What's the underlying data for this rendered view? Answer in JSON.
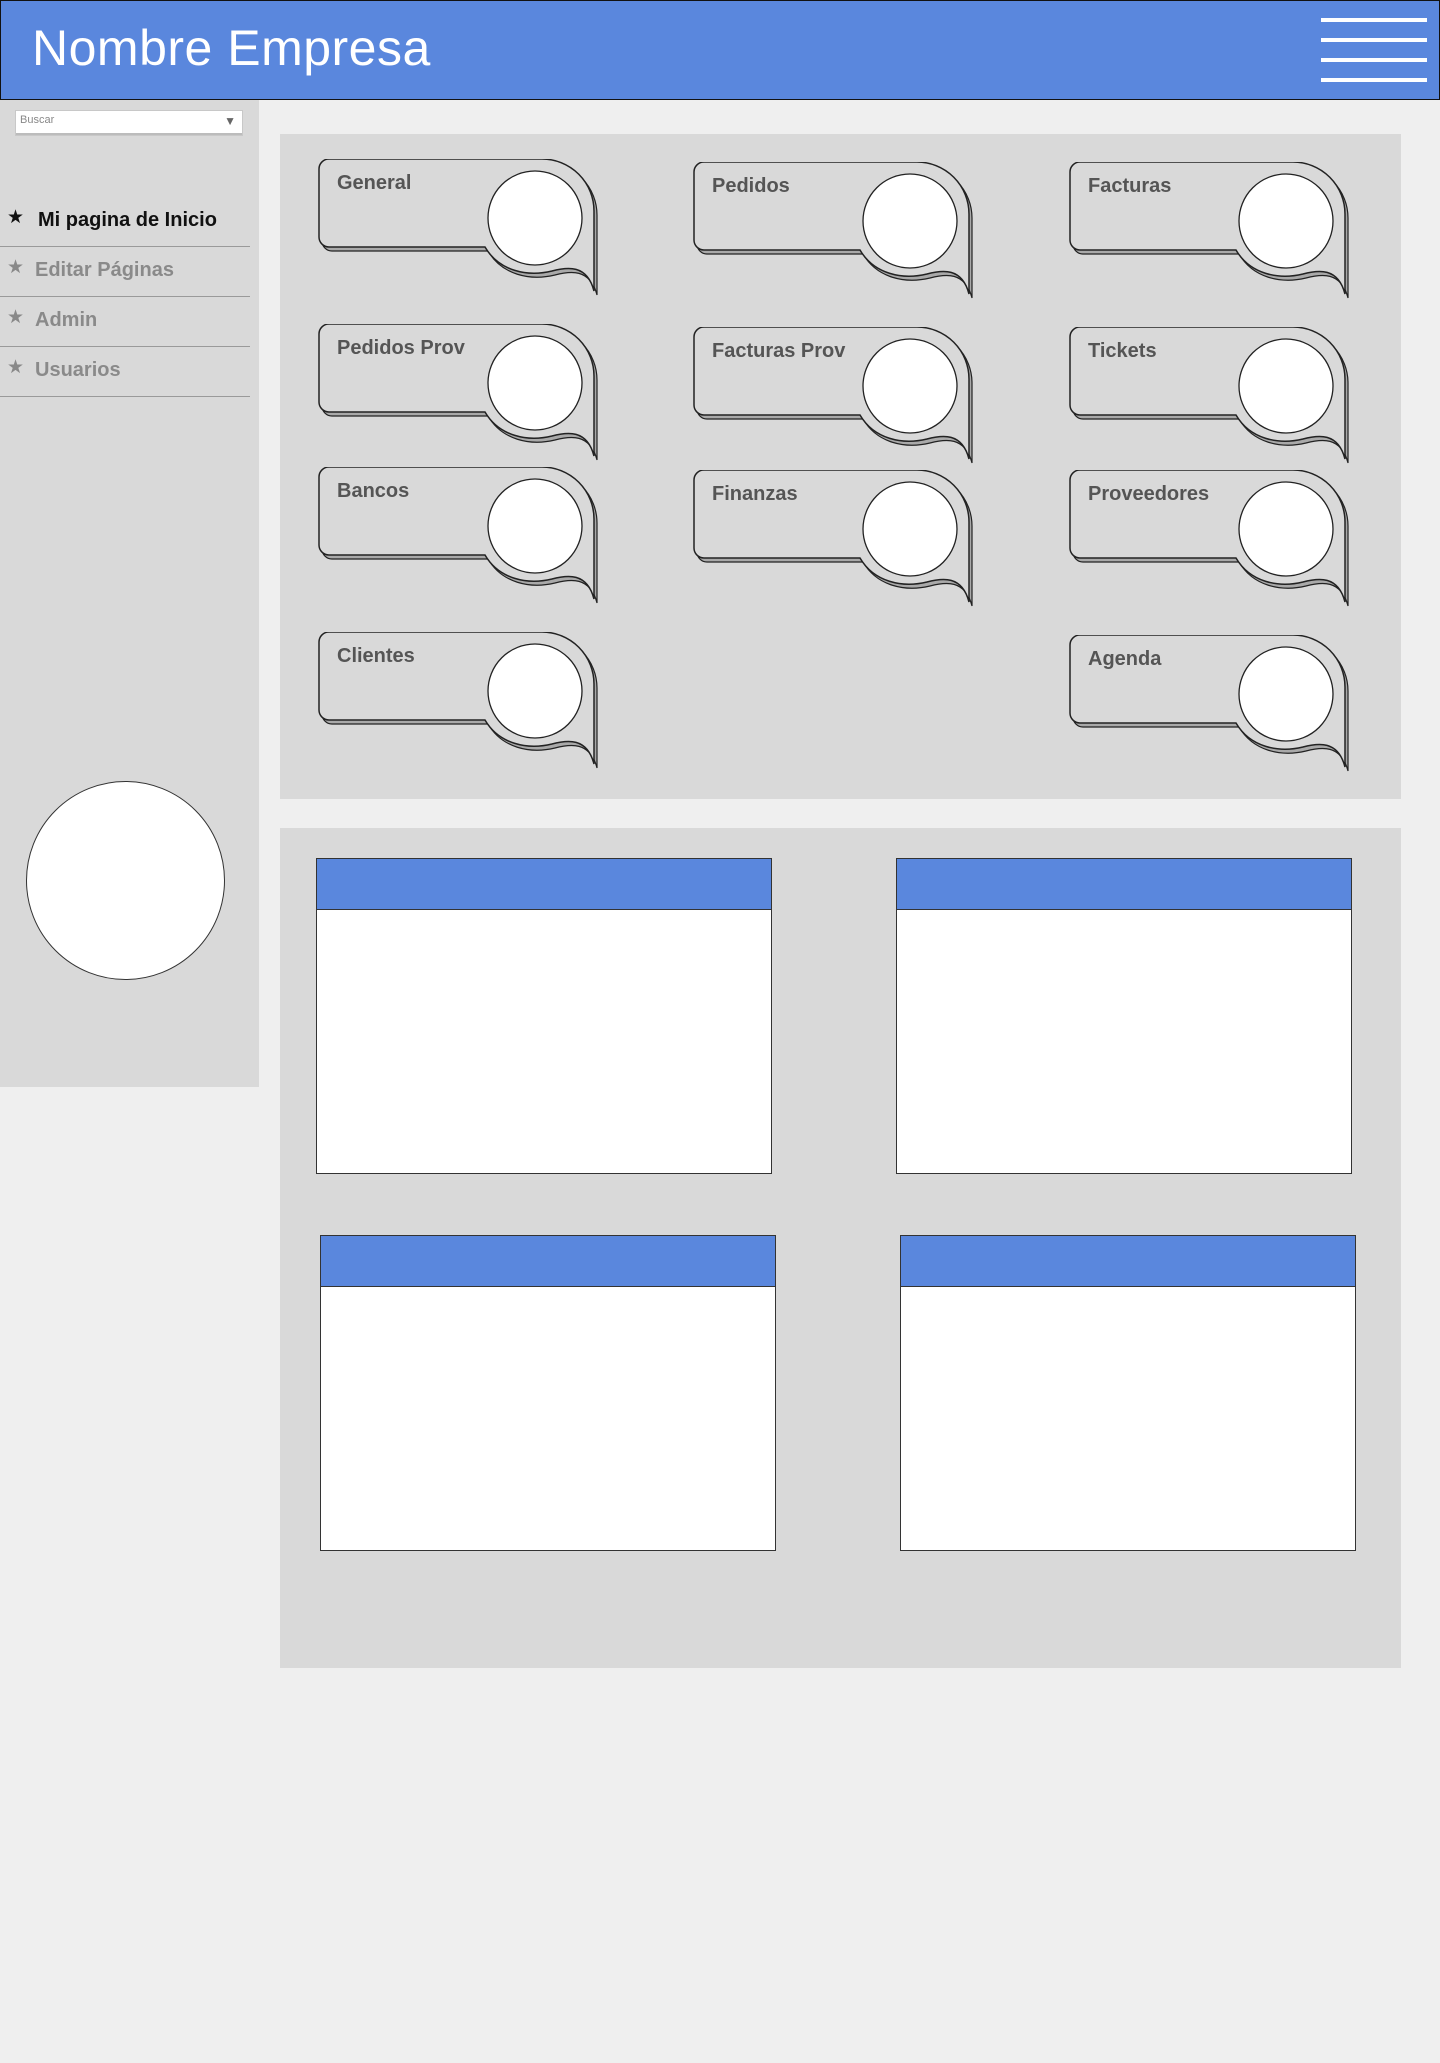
{
  "header": {
    "brand": "Nombre Empresa",
    "menu_icon": "hamburger-menu-icon",
    "color": "#5a87dd"
  },
  "sidebar": {
    "search": {
      "placeholder": "Buscar",
      "value": ""
    },
    "items": [
      {
        "label": "Mi pagina de Inicio",
        "icon": "star-icon",
        "active": true
      },
      {
        "label": "Editar Páginas",
        "icon": "star-icon",
        "active": false
      },
      {
        "label": "Admin",
        "icon": "star-icon",
        "active": false
      },
      {
        "label": "Usuarios",
        "icon": "star-icon",
        "active": false
      }
    ]
  },
  "tiles": [
    {
      "label": "General"
    },
    {
      "label": "Pedidos"
    },
    {
      "label": "Facturas"
    },
    {
      "label": "Pedidos Prov"
    },
    {
      "label": "Facturas Prov"
    },
    {
      "label": "Tickets"
    },
    {
      "label": "Bancos"
    },
    {
      "label": "Finanzas"
    },
    {
      "label": "Proveedores"
    },
    {
      "label": "Clientes"
    },
    {
      "label": "Agenda"
    }
  ],
  "widgets": [
    {},
    {},
    {},
    {}
  ]
}
